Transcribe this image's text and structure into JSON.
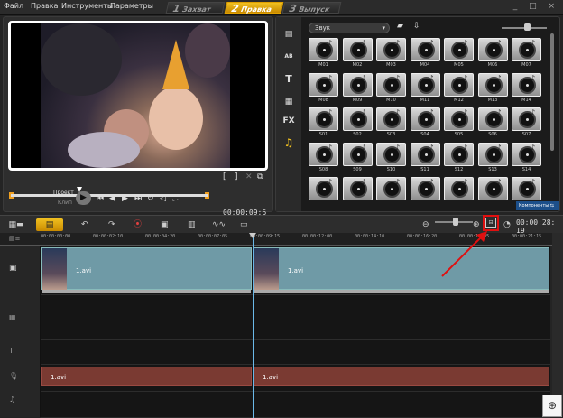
{
  "menu": {
    "file": "Файл",
    "edit": "Правка",
    "tools": "Инструменты",
    "settings": "Параметры"
  },
  "steps": [
    {
      "num": "1",
      "label": "Захват"
    },
    {
      "num": "2",
      "label": "Правка"
    },
    {
      "num": "3",
      "label": "Выпуск"
    }
  ],
  "window_controls": "_ □ ×",
  "preview": {
    "project_label": "Проект",
    "clip_label": "Клип",
    "timecode": "00:00:09:",
    "timecode_frames": "6",
    "bracket_in": "[",
    "bracket_out": "]"
  },
  "library": {
    "category": "Звук",
    "components_button": "Компоненты",
    "side_icons": {
      "media": "▤",
      "transition": "AB",
      "title": "T",
      "graphics": "▦",
      "fx": "FX",
      "audio": "♫"
    },
    "items": [
      "M01",
      "M02",
      "M03",
      "M04",
      "M05",
      "M06",
      "M07",
      "M08",
      "M09",
      "M10",
      "M11",
      "M12",
      "M13",
      "M14",
      "S01",
      "S02",
      "S03",
      "S04",
      "S05",
      "S06",
      "S07",
      "S08",
      "S09",
      "S10",
      "S11",
      "S12",
      "S13",
      "S14",
      "",
      "",
      "",
      "",
      "",
      "",
      ""
    ]
  },
  "timeline": {
    "timecode": "00:00:28:",
    "timecode_frames": "19",
    "ruler": [
      "00:00:00:00",
      "00:00:02:10",
      "00:00:04:20",
      "00:00:07:05",
      "00:00:09:15",
      "00:00:12:00",
      "00:00:14:10",
      "00:00:16:20",
      "00:00:19:05",
      "00:00:21:15"
    ],
    "video_clips": [
      "1.avi",
      "1.avi"
    ],
    "audio_clips": [
      "1.avi",
      "1.avi"
    ]
  },
  "accent": "#e0a000",
  "highlight_color": "#e01010"
}
